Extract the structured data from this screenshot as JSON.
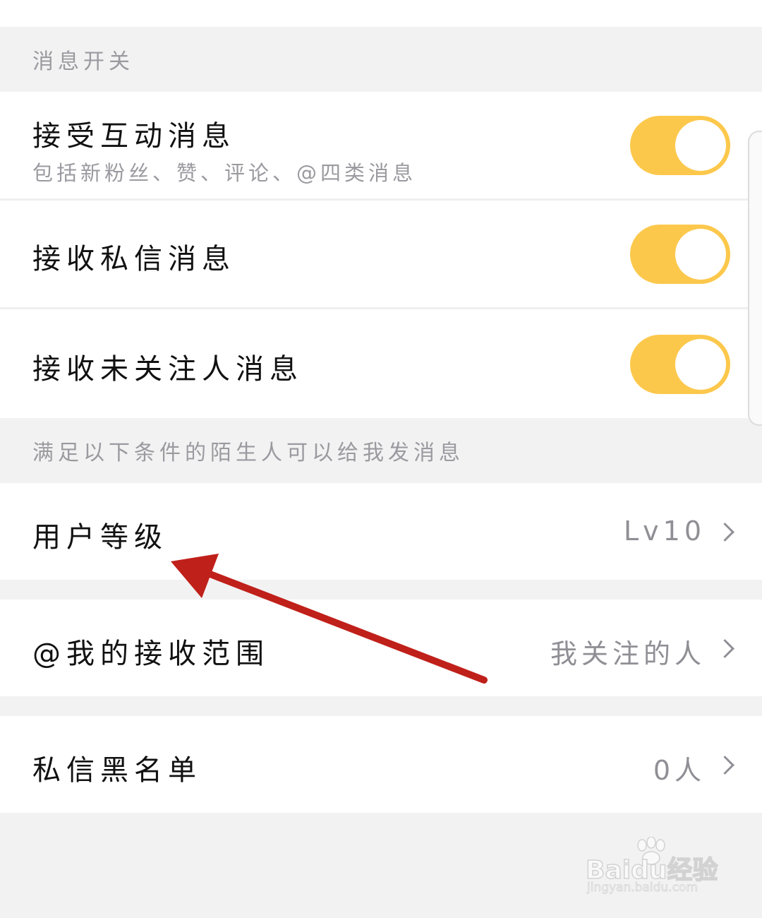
{
  "sections": {
    "message_switch_header": "消息开关",
    "stranger_header": "满足以下条件的陌生人可以给我发消息"
  },
  "toggles": [
    {
      "title": "接受互动消息",
      "subtitle": "包括新粉丝、赞、评论、@四类消息",
      "on": true
    },
    {
      "title": "接收私信消息",
      "on": true
    },
    {
      "title": "接收未关注人消息",
      "on": true
    }
  ],
  "settings": [
    {
      "title": "用户等级",
      "value": "Lv10"
    },
    {
      "title": "@我的接收范围",
      "value": "我关注的人"
    },
    {
      "title": "私信黑名单",
      "value": "0人"
    }
  ],
  "watermark": {
    "brand": "Baidu经验",
    "url": "jingyan.baidu.com"
  },
  "colors": {
    "toggle_on": "#fcc84c",
    "annotation_arrow": "#c0201a"
  }
}
